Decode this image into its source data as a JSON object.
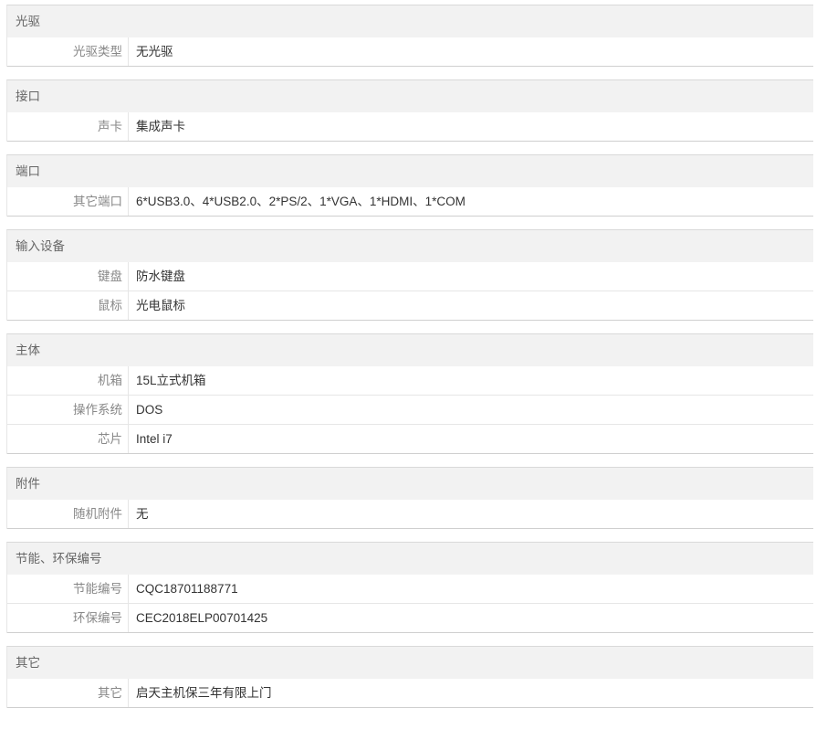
{
  "groups": [
    {
      "title": "光驱",
      "rows": [
        {
          "label": "光驱类型",
          "value": "无光驱"
        }
      ]
    },
    {
      "title": "接口",
      "rows": [
        {
          "label": "声卡",
          "value": "集成声卡"
        }
      ]
    },
    {
      "title": "端口",
      "rows": [
        {
          "label": "其它端口",
          "value": "6*USB3.0、4*USB2.0、2*PS/2、1*VGA、1*HDMI、1*COM"
        }
      ]
    },
    {
      "title": "输入设备",
      "rows": [
        {
          "label": "键盘",
          "value": "防水键盘"
        },
        {
          "label": "鼠标",
          "value": "光电鼠标"
        }
      ]
    },
    {
      "title": "主体",
      "rows": [
        {
          "label": "机箱",
          "value": "15L立式机箱"
        },
        {
          "label": "操作系统",
          "value": "DOS"
        },
        {
          "label": "芯片",
          "value": "Intel i7"
        }
      ]
    },
    {
      "title": "附件",
      "rows": [
        {
          "label": "随机附件",
          "value": "无"
        }
      ]
    },
    {
      "title": "节能、环保编号",
      "rows": [
        {
          "label": "节能编号",
          "value": "CQC18701188771"
        },
        {
          "label": "环保编号",
          "value": "CEC2018ELP00701425"
        }
      ]
    },
    {
      "title": "其它",
      "rows": [
        {
          "label": "其它",
          "value": "启天主机保三年有限上门"
        }
      ]
    }
  ]
}
